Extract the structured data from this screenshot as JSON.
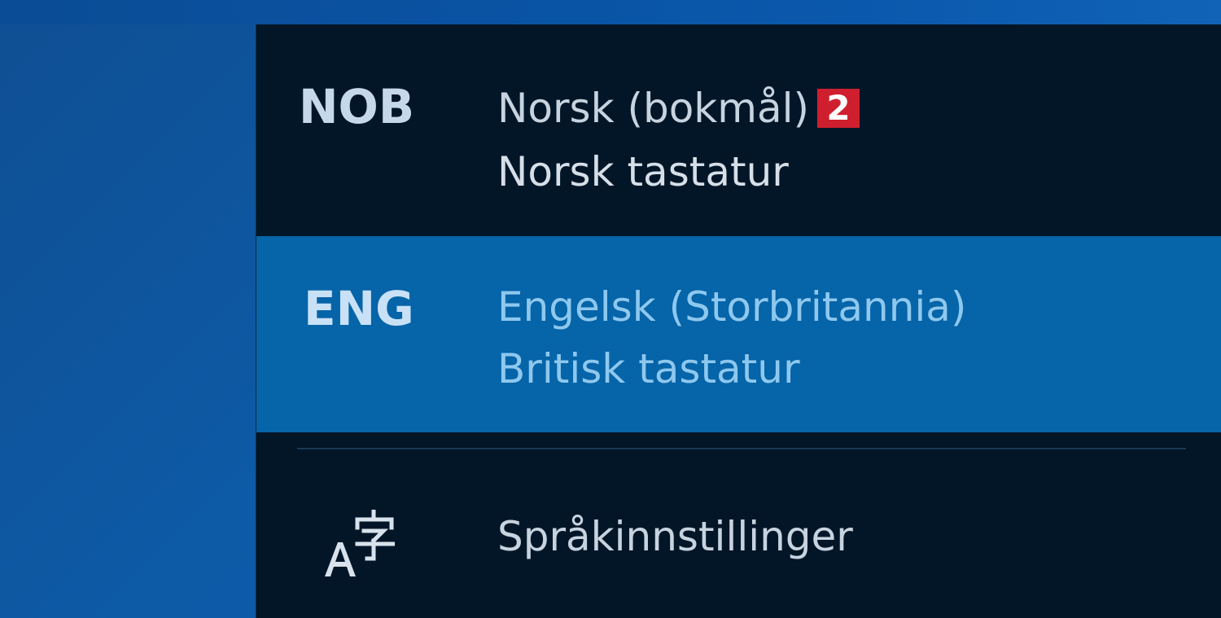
{
  "languages": [
    {
      "code": "NOB",
      "name": "Norsk (bokmål)",
      "badge": "2",
      "layout": "Norsk tastatur",
      "selected": false
    },
    {
      "code": "ENG",
      "name": "Engelsk (Storbritannia)",
      "layout": "Britisk tastatur",
      "selected": true
    }
  ],
  "settings": {
    "label": "Språkinnstillinger",
    "icon": "language-settings-icon"
  },
  "colors": {
    "desktop": "#0d5ba8",
    "flyout": "#021628",
    "selected": "#0664a8",
    "badge": "#cf1f2e"
  }
}
